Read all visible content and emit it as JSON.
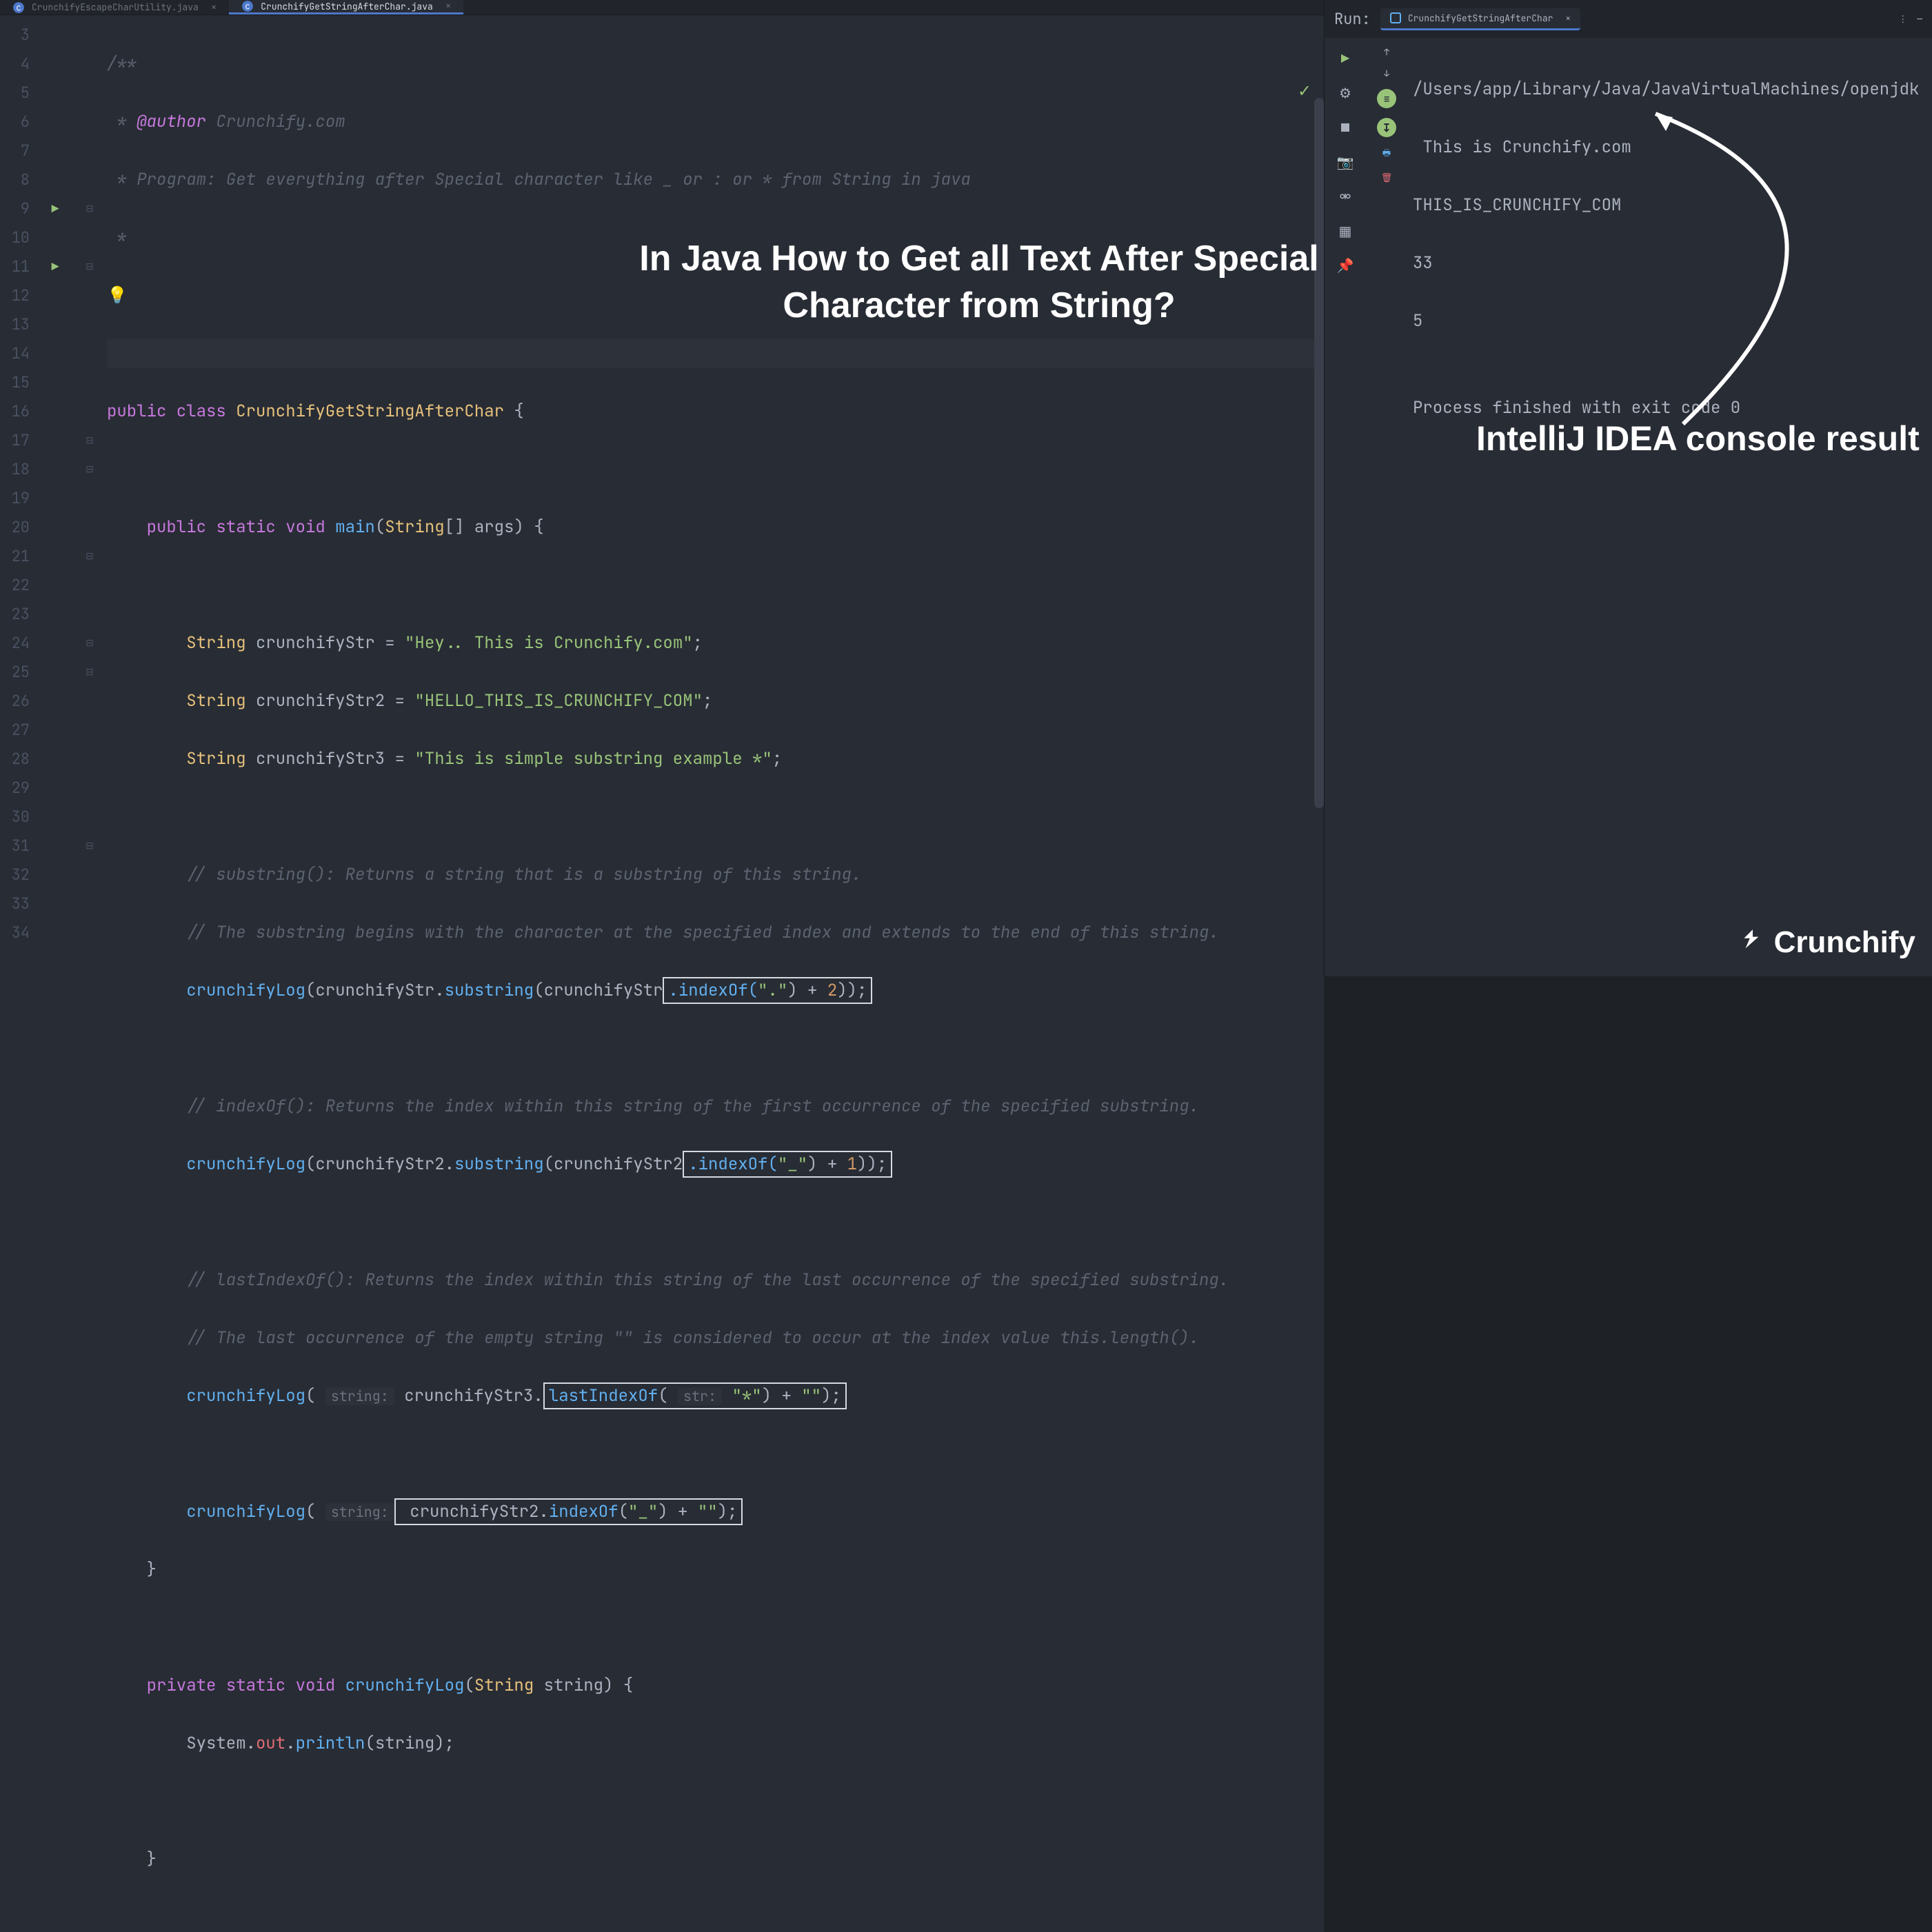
{
  "tabs": [
    {
      "name": "CrunchifyEscapeCharUtility.java",
      "active": false
    },
    {
      "name": "CrunchifyGetStringAfterChar.java",
      "active": true
    }
  ],
  "gutter_start": 3,
  "gutter_end": 34,
  "runnable_lines": [
    9,
    11
  ],
  "code": {
    "l3": "/**",
    "l4_prefix": " * ",
    "l4_tag": "@author",
    "l4_rest": " Crunchify.com",
    "l5": " * Program: Get everything after Special character like _ or : or * from String in java",
    "l6": " *",
    "l8": "",
    "l9_a": "public class ",
    "l9_b": "CrunchifyGetStringAfterChar",
    "l9_c": " {",
    "l11_a": "    public static void ",
    "l11_b": "main",
    "l11_c": "(",
    "l11_d": "String",
    "l11_e": "[] ",
    "l11_f": "args",
    "l11_g": ") {",
    "l13_a": "        String ",
    "l13_b": "crunchifyStr",
    "l13_c": " = ",
    "l13_d": "\"Hey.. This is Crunchify.com\"",
    "l13_e": ";",
    "l14_a": "        String ",
    "l14_b": "crunchifyStr2",
    "l14_c": " = ",
    "l14_d": "\"HELLO_THIS_IS_CRUNCHIFY_COM\"",
    "l14_e": ";",
    "l15_a": "        String ",
    "l15_b": "crunchifyStr3",
    "l15_c": " = ",
    "l15_d": "\"This is simple substring example *\"",
    "l15_e": ";",
    "l17": "        // substring(): Returns a string that is a substring of this string.",
    "l18": "        // The substring begins with the character at the specified index and extends to the end of this string.",
    "l19_a": "        crunchifyLog",
    "l19_b": "(crunchifyStr.",
    "l19_c": "substring",
    "l19_d": "(crunchifyStr",
    "l19_e": ".indexOf(",
    "l19_f": "\".\"",
    "l19_g": ") + ",
    "l19_h": "2",
    "l19_i": "));",
    "l21": "        // indexOf(): Returns the index within this string of the first occurrence of the specified substring.",
    "l22_a": "        crunchifyLog",
    "l22_b": "(crunchifyStr2.",
    "l22_c": "substring",
    "l22_d": "(crunchifyStr2",
    "l22_e": ".indexOf(",
    "l22_f": "\"_\"",
    "l22_g": ") + ",
    "l22_h": "1",
    "l22_i": "));",
    "l24": "        // lastIndexOf(): Returns the index within this string of the last occurrence of the specified substring.",
    "l25": "        // The last occurrence of the empty string \"\" is considered to occur at the index value this.length().",
    "l26_a": "        crunchifyLog",
    "l26_b": "( ",
    "l26_hint1": "string:",
    "l26_c": " crunchifyStr3.",
    "l26_d": "lastIndexOf",
    "l26_e": "( ",
    "l26_hint2": "str:",
    "l26_f": " ",
    "l26_g": "\"*\"",
    "l26_h": ") + ",
    "l26_i": "\"\"",
    "l26_j": ");",
    "l28_a": "        crunchifyLog",
    "l28_b": "( ",
    "l28_hint1": "string:",
    "l28_c": " crunchifyStr2.",
    "l28_d": "indexOf",
    "l28_e": "(",
    "l28_f": "\"_\"",
    "l28_g": ") + ",
    "l28_h": "\"\"",
    "l28_i": ");",
    "l29": "    }",
    "l31_a": "    private static void ",
    "l31_b": "crunchifyLog",
    "l31_c": "(",
    "l31_d": "String ",
    "l31_e": "string",
    "l31_f": ") {",
    "l32_a": "        System.",
    "l32_b": "out",
    "l32_c": ".",
    "l32_d": "println",
    "l32_e": "(string);",
    "l34": "    }"
  },
  "overlay": "In Java How to Get all Text After\nSpecial Character from String?",
  "run": {
    "label": "Run:",
    "config": "CrunchifyGetStringAfterChar",
    "console": [
      "/Users/app/Library/Java/JavaVirtualMachines/openjdk",
      " This is Crunchify.com",
      "THIS_IS_CRUNCHIFY_COM",
      "33",
      "5",
      "",
      "Process finished with exit code 0"
    ]
  },
  "annotation": "IntelliJ IDEA console result",
  "logo_text": "Crunchify"
}
